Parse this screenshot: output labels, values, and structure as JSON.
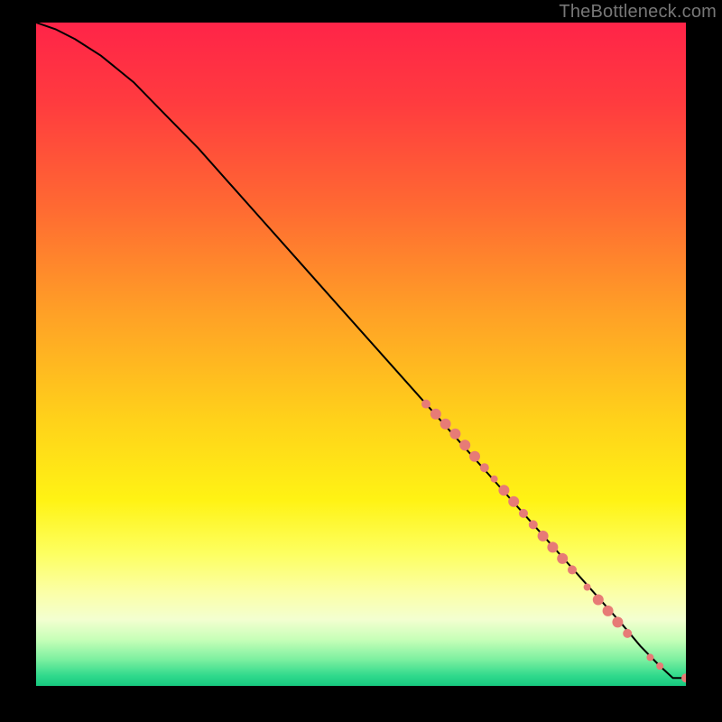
{
  "watermark": "TheBottleneck.com",
  "chart_data": {
    "type": "line",
    "title": "",
    "xlabel": "",
    "ylabel": "",
    "xlim": [
      0,
      100
    ],
    "ylim": [
      0,
      100
    ],
    "curve": {
      "x": [
        0,
        3,
        6,
        10,
        15,
        20,
        25,
        30,
        35,
        40,
        45,
        50,
        55,
        60,
        65,
        70,
        75,
        80,
        85,
        90,
        93,
        96,
        98,
        100
      ],
      "y": [
        100,
        99,
        97.5,
        95,
        91,
        86,
        81,
        75.5,
        70,
        64.5,
        59,
        53.5,
        48,
        42.5,
        37,
        31.5,
        26,
        20.5,
        15,
        9.5,
        6,
        3,
        1.2,
        1.2
      ]
    },
    "marker_color": "#e77b76",
    "markers": [
      {
        "x": 60.0,
        "y": 42.5,
        "r": 5
      },
      {
        "x": 61.5,
        "y": 41.0,
        "r": 6
      },
      {
        "x": 63.0,
        "y": 39.5,
        "r": 6
      },
      {
        "x": 64.5,
        "y": 38.0,
        "r": 6
      },
      {
        "x": 66.0,
        "y": 36.3,
        "r": 6
      },
      {
        "x": 67.5,
        "y": 34.6,
        "r": 6
      },
      {
        "x": 69.0,
        "y": 32.9,
        "r": 5
      },
      {
        "x": 70.5,
        "y": 31.2,
        "r": 4
      },
      {
        "x": 72.0,
        "y": 29.5,
        "r": 6
      },
      {
        "x": 73.5,
        "y": 27.8,
        "r": 6
      },
      {
        "x": 75.0,
        "y": 26.0,
        "r": 5
      },
      {
        "x": 76.5,
        "y": 24.3,
        "r": 5
      },
      {
        "x": 78.0,
        "y": 22.6,
        "r": 6
      },
      {
        "x": 79.5,
        "y": 20.9,
        "r": 6
      },
      {
        "x": 81.0,
        "y": 19.2,
        "r": 6
      },
      {
        "x": 82.5,
        "y": 17.5,
        "r": 5
      },
      {
        "x": 84.8,
        "y": 14.9,
        "r": 4
      },
      {
        "x": 86.5,
        "y": 13.0,
        "r": 6
      },
      {
        "x": 88.0,
        "y": 11.3,
        "r": 6
      },
      {
        "x": 89.5,
        "y": 9.6,
        "r": 6
      },
      {
        "x": 91.0,
        "y": 7.9,
        "r": 5
      },
      {
        "x": 94.5,
        "y": 4.3,
        "r": 4
      },
      {
        "x": 96.0,
        "y": 3.0,
        "r": 4
      },
      {
        "x": 100.0,
        "y": 1.2,
        "r": 5
      }
    ],
    "background_gradient": {
      "stops": [
        {
          "offset": 0.0,
          "color": "#ff2448"
        },
        {
          "offset": 0.12,
          "color": "#ff3b3f"
        },
        {
          "offset": 0.28,
          "color": "#ff6a32"
        },
        {
          "offset": 0.44,
          "color": "#ffa126"
        },
        {
          "offset": 0.6,
          "color": "#ffd21a"
        },
        {
          "offset": 0.72,
          "color": "#fff314"
        },
        {
          "offset": 0.8,
          "color": "#fdff60"
        },
        {
          "offset": 0.86,
          "color": "#fbffa8"
        },
        {
          "offset": 0.9,
          "color": "#f3ffd0"
        },
        {
          "offset": 0.93,
          "color": "#c7ffb8"
        },
        {
          "offset": 0.96,
          "color": "#7df0a0"
        },
        {
          "offset": 0.985,
          "color": "#2fd98c"
        },
        {
          "offset": 1.0,
          "color": "#17c97f"
        }
      ]
    }
  }
}
